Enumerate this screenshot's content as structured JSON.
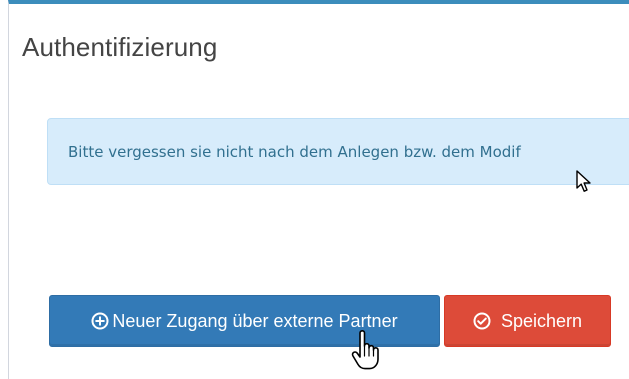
{
  "panel": {
    "title": "Authentifizierung",
    "accent_color": "#3c8dbc"
  },
  "alert": {
    "text": "Bitte vergessen sie nicht nach dem Anlegen bzw. dem Modif",
    "background_color": "#d7ecfb",
    "text_color": "#31708f"
  },
  "actions": {
    "new_access": {
      "label": "Neuer Zugang über externe Partner",
      "icon": "plus-circle-icon",
      "color": "#337ab7"
    },
    "save": {
      "label": "Speichern",
      "icon": "check-circle-icon",
      "color": "#dd4b39"
    }
  },
  "cursors": {
    "pointer": "arrow-cursor-icon",
    "hand": "hand-pointer-icon"
  }
}
